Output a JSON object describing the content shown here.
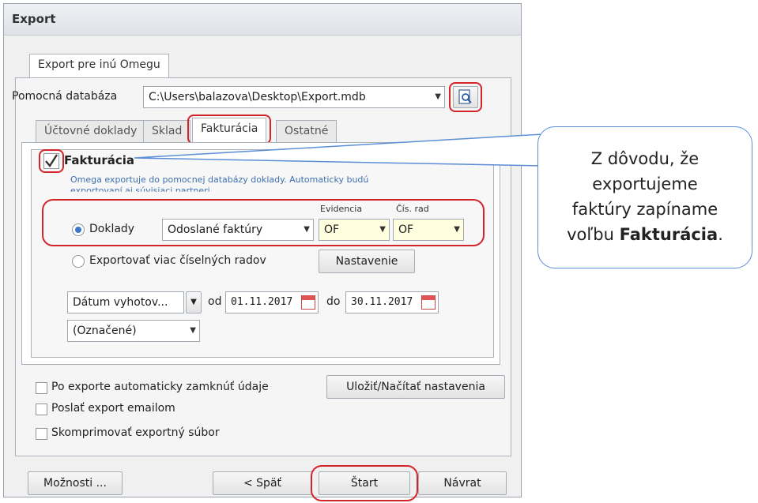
{
  "window": {
    "title": "Export"
  },
  "tabs_top": [
    {
      "label": "Export pre inú Omegu"
    }
  ],
  "db": {
    "label": "Pomocná databáza",
    "path": "C:\\Users\\balazova\\Desktop\\Export.mdb"
  },
  "sub_tabs": [
    {
      "label": "Účtovné doklady"
    },
    {
      "label": "Sklad"
    },
    {
      "label": "Fakturácia"
    },
    {
      "label": "Ostatné"
    }
  ],
  "fakturacia": {
    "checkbox_label": "Fakturácia",
    "info_line1": "Omega exportuje do pomocnej databázy doklady. Automaticky budú",
    "info_line2": "exportovaní aj súvisiaci partneri.",
    "col_evidencia": "Evidencia",
    "col_cis_rad": "Čís. rad",
    "radio_doklady": "Doklady",
    "doklady_type": "Odoslané faktúry",
    "evidencia_value": "OF",
    "cis_rad_value": "OF",
    "radio_viac": "Exportovať viac číselných radov",
    "nastavenie_button": "Nastavenie",
    "date_field": "Dátum vyhotov...",
    "od_label": "od",
    "date_from": "01.11.2017",
    "do_label": "do",
    "date_to": "30.11.2017",
    "filter": "(Označené)"
  },
  "options": {
    "close_data": "Po exporte automaticky zamknúť údaje",
    "email": "Poslať export emailom",
    "compress": "Skomprimovať exportný súbor",
    "save_load_button": "Uložiť/Načítať nastavenia"
  },
  "footer": {
    "moznosti": "Možnosti ...",
    "spat": "< Späť",
    "start": "Štart",
    "navrat": "Návrat"
  },
  "callout": {
    "line1": "Z dôvodu, že",
    "line2": "exportujeme",
    "line3": "faktúry zapíname",
    "line4_prefix": "voľbu ",
    "line4_bold": "Fakturácia",
    "line4_suffix": "."
  },
  "colors": {
    "annotation_red": "#d3242a",
    "callout_blue": "#5b8ed6"
  }
}
